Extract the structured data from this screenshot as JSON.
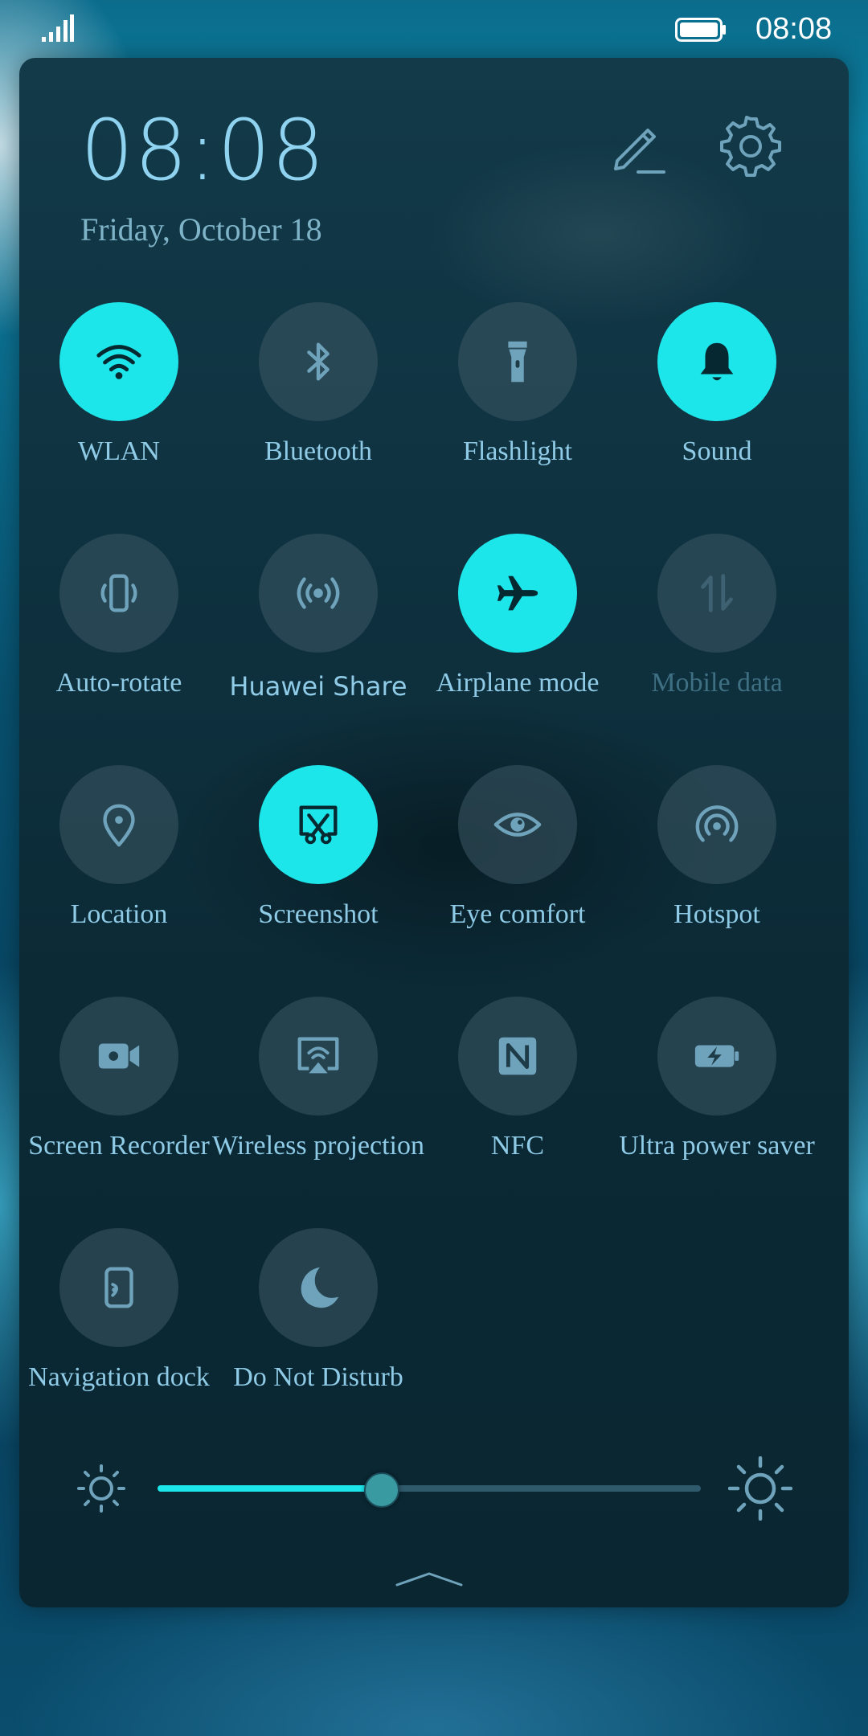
{
  "status_bar": {
    "time": "08:08",
    "signal_icon": "signal-icon",
    "battery_icon": "battery-icon"
  },
  "header": {
    "clock": "08:08",
    "date": "Friday, October 18",
    "edit_icon": "pencil-icon",
    "settings_icon": "gear-icon"
  },
  "tiles": [
    {
      "label": "WLAN",
      "icon": "wifi-icon",
      "on": true
    },
    {
      "label": "Bluetooth",
      "icon": "bluetooth-icon",
      "on": false
    },
    {
      "label": "Flashlight",
      "icon": "flashlight-icon",
      "on": false
    },
    {
      "label": "Sound",
      "icon": "bell-icon",
      "on": true
    },
    {
      "label": "Auto-rotate",
      "icon": "rotate-phone-icon",
      "on": false
    },
    {
      "label": "Huawei Share",
      "icon": "share-signal-icon",
      "on": false
    },
    {
      "label": "Airplane mode",
      "icon": "airplane-icon",
      "on": true
    },
    {
      "label": "Mobile data",
      "icon": "mobile-data-icon",
      "on": false,
      "disabled": true
    },
    {
      "label": "Location",
      "icon": "location-pin-icon",
      "on": false
    },
    {
      "label": "Screenshot",
      "icon": "screenshot-scissors-icon",
      "on": true
    },
    {
      "label": "Eye comfort",
      "icon": "eye-icon",
      "on": false
    },
    {
      "label": "Hotspot",
      "icon": "hotspot-icon",
      "on": false
    },
    {
      "label": "Screen Recorder",
      "icon": "video-camera-icon",
      "on": false
    },
    {
      "label": "Wireless projection",
      "icon": "wireless-projection-icon",
      "on": false
    },
    {
      "label": "NFC",
      "icon": "nfc-icon",
      "on": false
    },
    {
      "label": "Ultra power saver",
      "icon": "battery-bolt-icon",
      "on": false
    },
    {
      "label": "Navigation dock",
      "icon": "navigation-dock-icon",
      "on": false
    },
    {
      "label": "Do Not Disturb",
      "icon": "moon-icon",
      "on": false
    }
  ],
  "brightness": {
    "level": 0.41,
    "low_icon": "sun-small-icon",
    "high_icon": "sun-large-icon"
  },
  "colors": {
    "accent": "#1de6ea",
    "label": "#8fcbe6",
    "tile_off": "#3c5864"
  }
}
